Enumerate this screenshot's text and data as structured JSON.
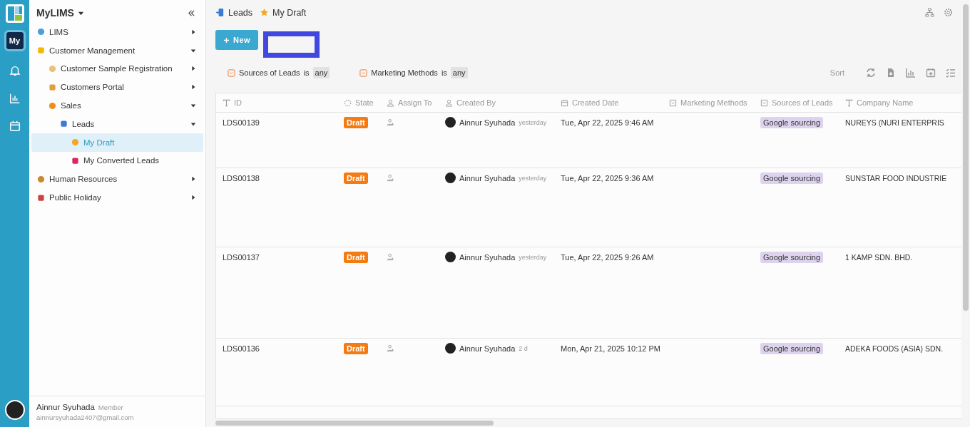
{
  "app": {
    "title": "MyLIMS",
    "rail_badge": "My"
  },
  "sidebar": {
    "items": [
      {
        "label": "LIMS",
        "expanded": false,
        "selected": false
      },
      {
        "label": "Customer Management",
        "expanded": true,
        "selected": false,
        "children": [
          {
            "label": "Customer Sample Registration",
            "expanded": false,
            "selected": false
          },
          {
            "label": "Customers Portal",
            "expanded": false,
            "selected": false
          },
          {
            "label": "Sales",
            "expanded": true,
            "selected": false,
            "children": [
              {
                "label": "Leads",
                "expanded": true,
                "selected": false,
                "children": [
                  {
                    "label": "My Draft",
                    "selected": true
                  },
                  {
                    "label": "My Converted Leads",
                    "selected": false
                  }
                ]
              }
            ]
          }
        ]
      },
      {
        "label": "Human Resources",
        "expanded": false,
        "selected": false
      },
      {
        "label": "Public Holiday",
        "expanded": false,
        "selected": false
      }
    ]
  },
  "user": {
    "name": "Ainnur Syuhada",
    "role": "Member",
    "email": "ainnursyuhada2407@gmail.com"
  },
  "breadcrumb": [
    "Leads",
    "My Draft"
  ],
  "new_button": "New",
  "filters": [
    {
      "field": "Sources of Leads",
      "op": "is",
      "value": "any"
    },
    {
      "field": "Marketing Methods",
      "op": "is",
      "value": "any"
    }
  ],
  "sort_label": "Sort",
  "table": {
    "columns": [
      "ID",
      "State",
      "Assign To",
      "Created By",
      "Created Date",
      "Marketing Methods",
      "Sources of Leads",
      "Company Name"
    ],
    "rows": [
      {
        "id": "LDS00139",
        "state": "Draft",
        "created_by": "Ainnur Syuhada",
        "created_ago": "yesterday",
        "created_date": "Tue, Apr 22, 2025 9:46 AM",
        "source": "Google sourcing",
        "company": "NUREYS (NURI ENTERPRIS"
      },
      {
        "id": "LDS00138",
        "state": "Draft",
        "created_by": "Ainnur Syuhada",
        "created_ago": "yesterday",
        "created_date": "Tue, Apr 22, 2025 9:36 AM",
        "source": "Google sourcing",
        "company": "SUNSTAR FOOD INDUSTRIE"
      },
      {
        "id": "LDS00137",
        "state": "Draft",
        "created_by": "Ainnur Syuhada",
        "created_ago": "yesterday",
        "created_date": "Tue, Apr 22, 2025 9:26 AM",
        "source": "Google sourcing",
        "company": "1 KAMP SDN. BHD."
      },
      {
        "id": "LDS00136",
        "state": "Draft",
        "created_by": "Ainnur Syuhada",
        "created_ago": "2 d",
        "created_date": "Mon, Apr 21, 2025 10:12 PM",
        "source": "Google sourcing",
        "company": "ADEKA FOODS (ASIA) SDN."
      }
    ]
  }
}
